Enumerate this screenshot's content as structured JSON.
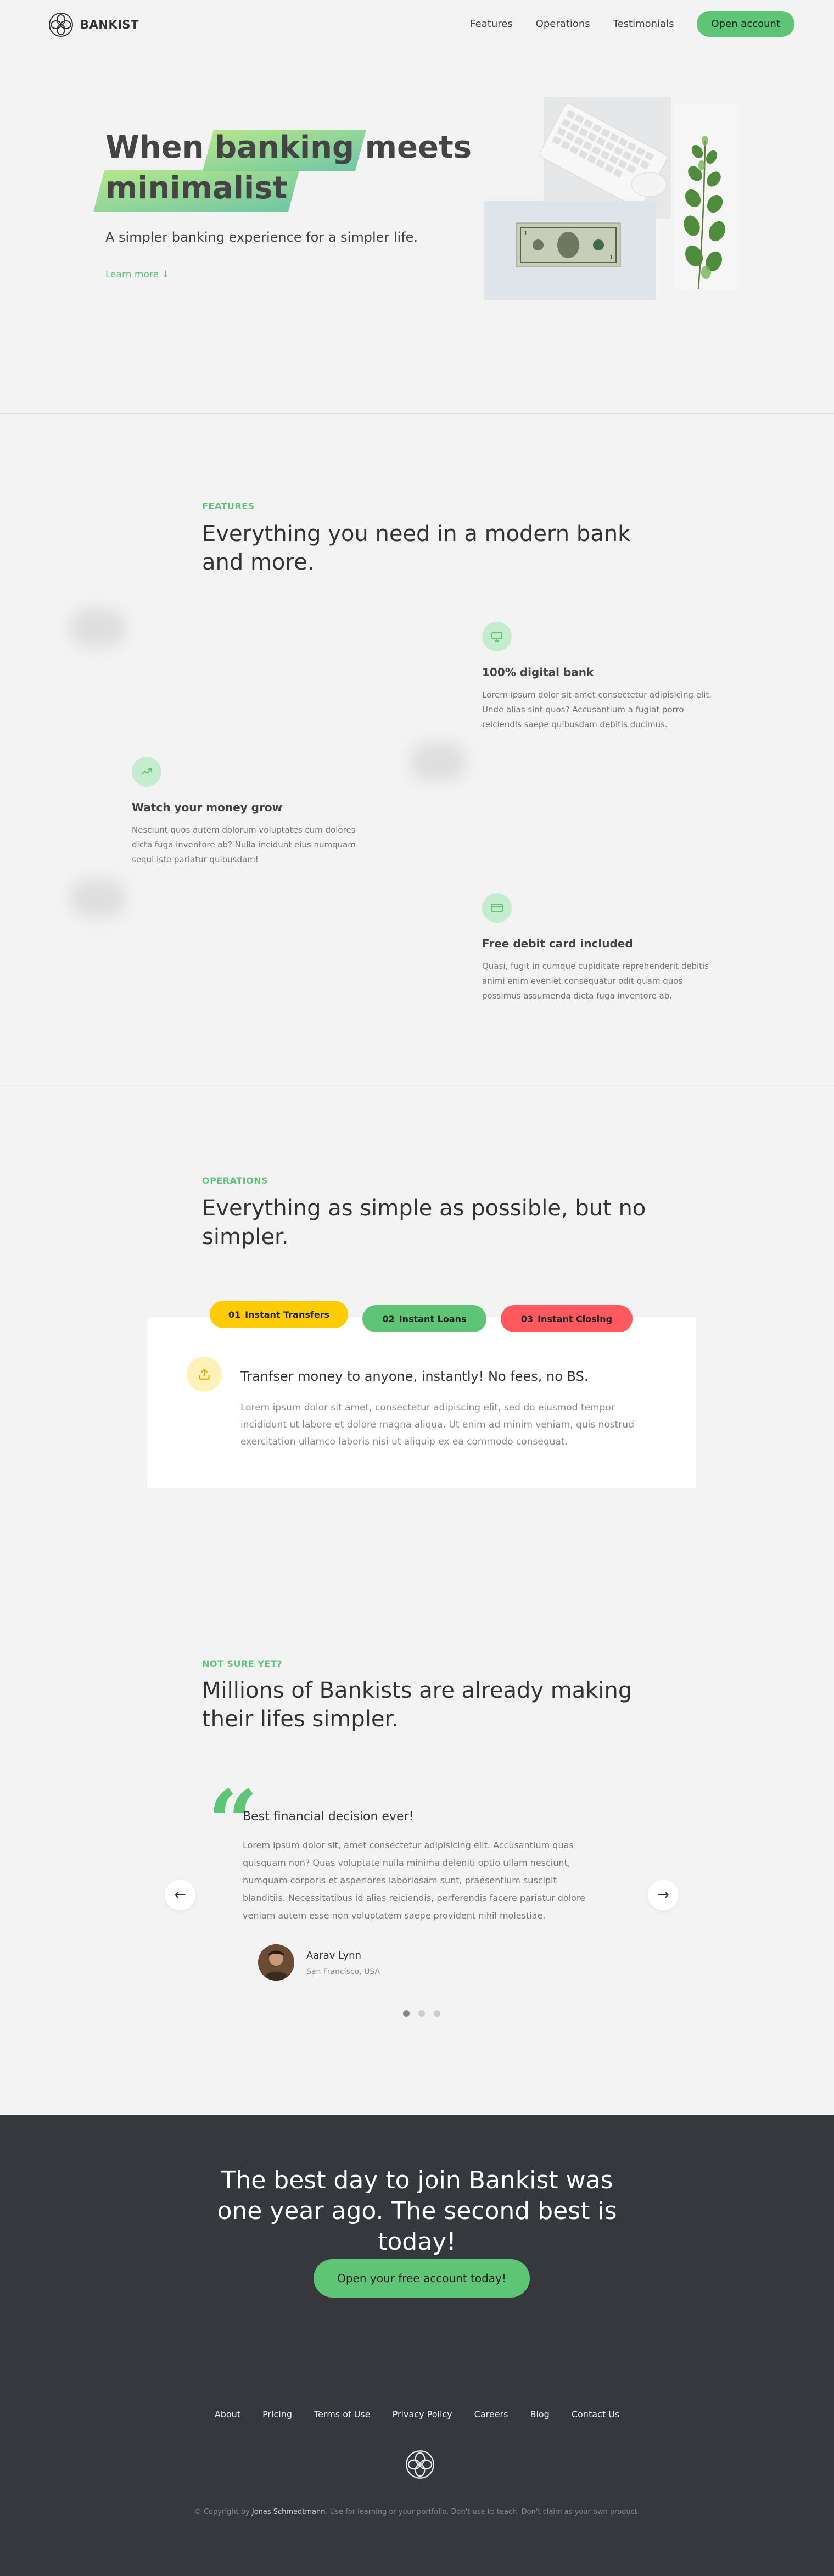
{
  "nav": {
    "brand": "BANKIST",
    "links": [
      "Features",
      "Operations",
      "Testimonials"
    ],
    "cta": "Open account"
  },
  "hero": {
    "title_pre": "When",
    "title_hl1": "banking",
    "title_mid": "meets",
    "title_hl2": "minimalist",
    "subtitle": "A simpler banking experience for a simpler life.",
    "learn_more": "Learn more ↓"
  },
  "features": {
    "label": "FEATURES",
    "title": "Everything you need in a modern bank and more.",
    "items": [
      {
        "icon": "monitor-icon",
        "title": "100% digital bank",
        "text": "Lorem ipsum dolor sit amet consectetur adipisicing elit. Unde alias sint quos? Accusantium a fugiat porro reiciendis saepe quibusdam debitis ducimus."
      },
      {
        "icon": "trending-up-icon",
        "title": "Watch your money grow",
        "text": "Nesciunt quos autem dolorum voluptates cum dolores dicta fuga inventore ab? Nulla incidunt eius numquam sequi iste pariatur quibusdam!"
      },
      {
        "icon": "credit-card-icon",
        "title": "Free debit card included",
        "text": "Quasi, fugit in cumque cupiditate reprehenderit debitis animi enim eveniet consequatur odit quam quos possimus assumenda dicta fuga inventore ab."
      }
    ]
  },
  "operations": {
    "label": "OPERATIONS",
    "title": "Everything as simple as possible, but no simpler.",
    "tabs": [
      {
        "num": "01",
        "label": "Instant Transfers",
        "color": "#ffcb03"
      },
      {
        "num": "02",
        "label": "Instant Loans",
        "color": "#5ec576"
      },
      {
        "num": "03",
        "label": "Instant Closing",
        "color": "#ff585f"
      }
    ],
    "heading": "Tranfser money to anyone, instantly! No fees, no BS.",
    "text": "Lorem ipsum dolor sit amet, consectetur adipiscing elit, sed do eiusmod tempor incididunt ut labore et dolore magna aliqua. Ut enim ad minim veniam, quis nostrud exercitation ullamco laboris nisi ut aliquip ex ea commodo consequat."
  },
  "testimonials": {
    "label": "NOT SURE YET?",
    "title": "Millions of Bankists are already making their lifes simpler.",
    "heading": "Best financial decision ever!",
    "text": "Lorem ipsum dolor sit, amet consectetur adipisicing elit. Accusantium quas quisquam non? Quas voluptate nulla minima deleniti optio ullam nesciunt, numquam corporis et asperiores laboriosam sunt, praesentium suscipit blanditiis. Necessitatibus id alias reiciendis, perferendis facere pariatur dolore veniam autem esse non voluptatem saepe provident nihil molestiae.",
    "name": "Aarav Lynn",
    "location": "San Francisco, USA",
    "prev": "←",
    "next": "→"
  },
  "signup": {
    "title": "The best day to join Bankist was one year ago. The second best is today!",
    "cta": "Open your free account today!"
  },
  "footer": {
    "links": [
      "About",
      "Pricing",
      "Terms of Use",
      "Privacy Policy",
      "Careers",
      "Blog",
      "Contact Us"
    ],
    "copy_pre": "© Copyright by",
    "copy_author": "Jonas Schmedtmann",
    "copy_post": ". Use for learning or your portfolio. Don't use to teach. Don't claim as your own product."
  },
  "colors": {
    "accent": "#5ec576",
    "yellow": "#ffcb03",
    "red": "#ff585f",
    "dark": "#37383d"
  }
}
